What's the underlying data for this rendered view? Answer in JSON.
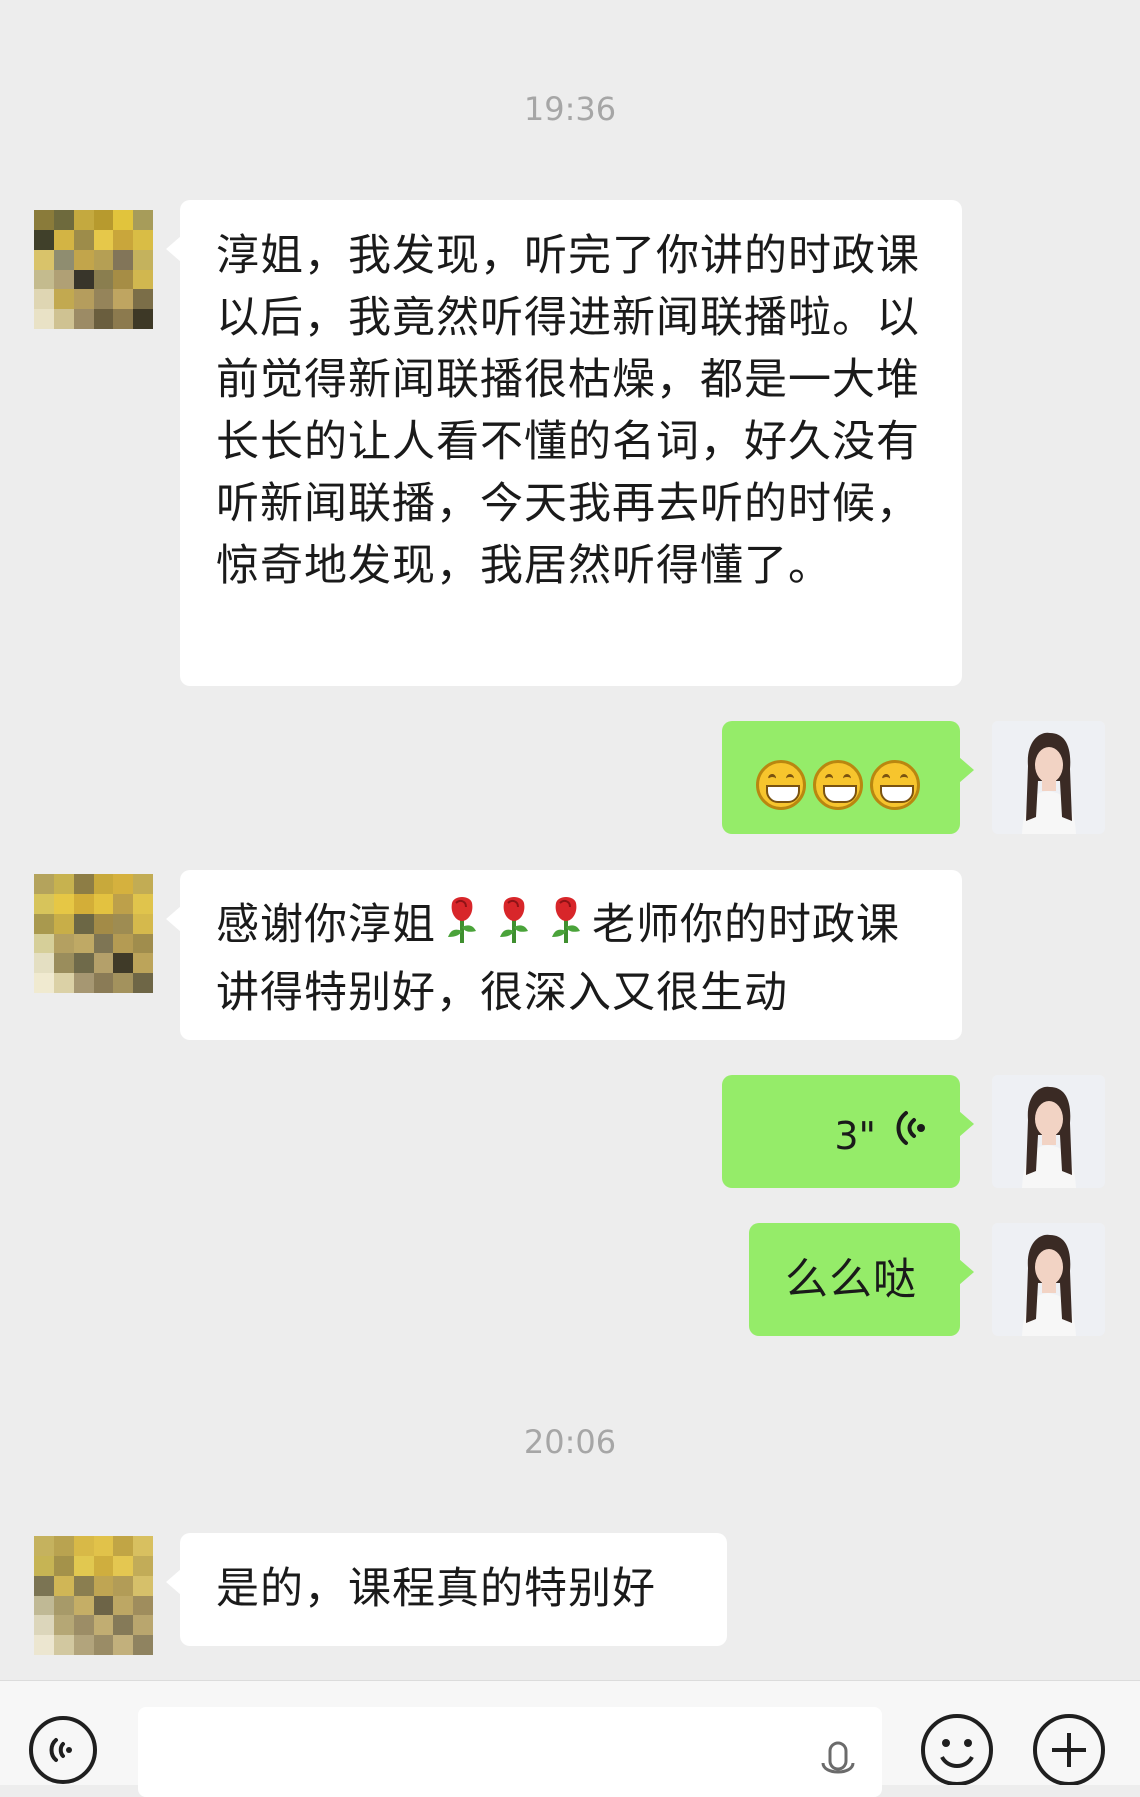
{
  "timestamps": [
    "19:36",
    "20:06"
  ],
  "messages": {
    "m1": "淳姐，我发现，听完了你讲的时政课以后，我竟然听得进新闻联播啦。以前觉得新闻联播很枯燥，都是一大堆长长的让人看不懂的名词，好久没有听新闻联播，今天我再去听的时候，惊奇地发现，我居然听得懂了。",
    "m2_emojis": [
      "grinning-face",
      "grinning-face",
      "grinning-face"
    ],
    "m3_part1": "感谢你淳姐",
    "m3_roses": [
      "rose",
      "rose",
      "rose"
    ],
    "m3_part2": "老师你的时政课讲得特别好，很深入又很生动",
    "m4_voice_duration": "3\"",
    "m5": "么么哒",
    "m6": "是的，课程真的特别好"
  },
  "input_bar": {
    "voice_toggle_icon": "voice-wave-icon",
    "mic_icon": "microphone-icon",
    "emoji_icon": "smiley-icon",
    "plus_icon": "plus-icon"
  },
  "colors": {
    "background": "#ededed",
    "incoming_bubble": "#ffffff",
    "outgoing_bubble": "#95ec69",
    "timestamp": "#a6a6a6"
  }
}
